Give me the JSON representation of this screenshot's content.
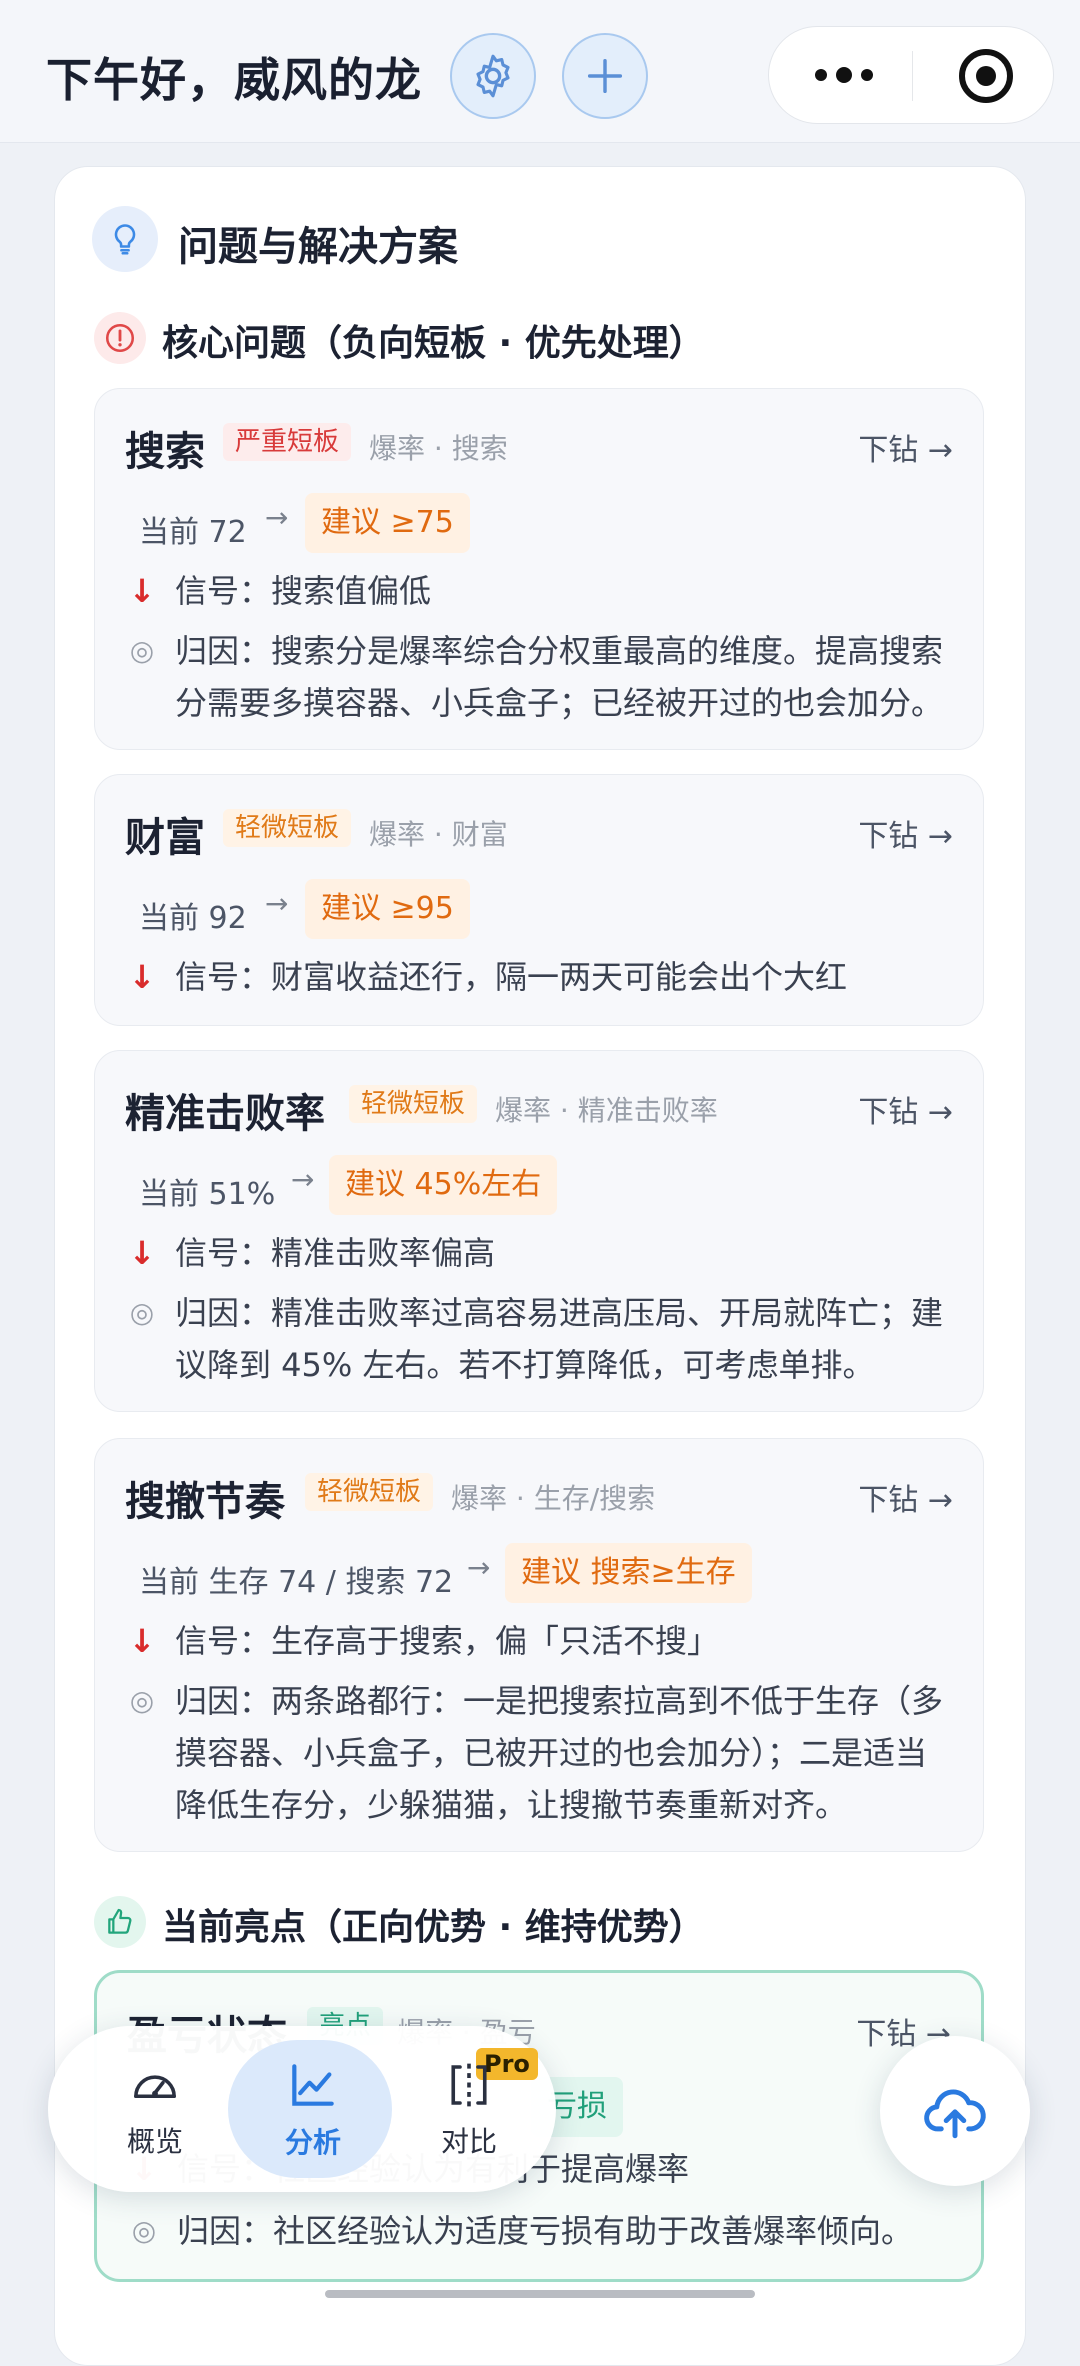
{
  "header": {
    "greeting": "下午好，威风的龙"
  },
  "panel": {
    "title": "问题与解决方案"
  },
  "core_section": {
    "title": "核心问题（负向短板 · 优先处理）"
  },
  "highlight_section": {
    "title": "当前亮点（正向优势 · 维持优势）"
  },
  "labels": {
    "current": "当前",
    "signal": "信号：",
    "cause": "归因：",
    "drill": "下钻 →"
  },
  "cards": [
    {
      "name": "搜索",
      "tag": "严重短板",
      "crumb": "爆率 · 搜索",
      "current": "72",
      "suggest": "建议 ≥75",
      "signal": "搜索值偏低",
      "cause": "搜索分是爆率综合分权重最高的维度。提高搜索分需要多摸容器、小兵盒子；已经被开过的也会加分。"
    },
    {
      "name": "财富",
      "tag": "轻微短板",
      "crumb": "爆率 · 财富",
      "current": "92",
      "suggest": "建议 ≥95",
      "signal": "财富收益还行，隔一两天可能会出个大红"
    },
    {
      "name": "精准击败率",
      "tag": "轻微短板",
      "crumb": "爆率 · 精准击败率",
      "current": "51%",
      "suggest": "建议 45%左右",
      "signal": "精准击败率偏高",
      "cause": "精准击败率过高容易进高压局、开局就阵亡；建议降到 45% 左右。若不打算降低，可考虑单排。"
    },
    {
      "name": "搜撤节奏",
      "tag": "轻微短板",
      "crumb": "爆率 · 生存/搜索",
      "current": "生存 74 / 搜索 72",
      "suggest": "建议 搜索≥生存",
      "signal": "生存高于搜索，偏「只活不搜」",
      "cause": "两条路都行：一是把搜索拉高到不低于生存（多摸容器、小兵盒子，已被开过的也会加分）；二是适当降低生存分，少躲猫猫，让搜撤节奏重新对齐。"
    }
  ],
  "highlight_card": {
    "name": "盈亏状态",
    "tag": "亮点",
    "crumb": "爆率 · 盈亏",
    "suggest": "亏损",
    "signal": "社区经验认为有利于提高爆率",
    "cause": "社区经验认为适度亏损有助于改善爆率倾向。"
  },
  "nav": {
    "items": [
      {
        "label": "概览",
        "icon": "gauge-icon"
      },
      {
        "label": "分析",
        "icon": "line-chart-icon"
      },
      {
        "label": "对比",
        "icon": "compare-icon"
      }
    ],
    "pro_badge": "Pro"
  },
  "colors": {
    "accent": "#2a7ae0",
    "severe": "#d83a3a",
    "slight": "#e07a18",
    "good": "#20a07a"
  }
}
